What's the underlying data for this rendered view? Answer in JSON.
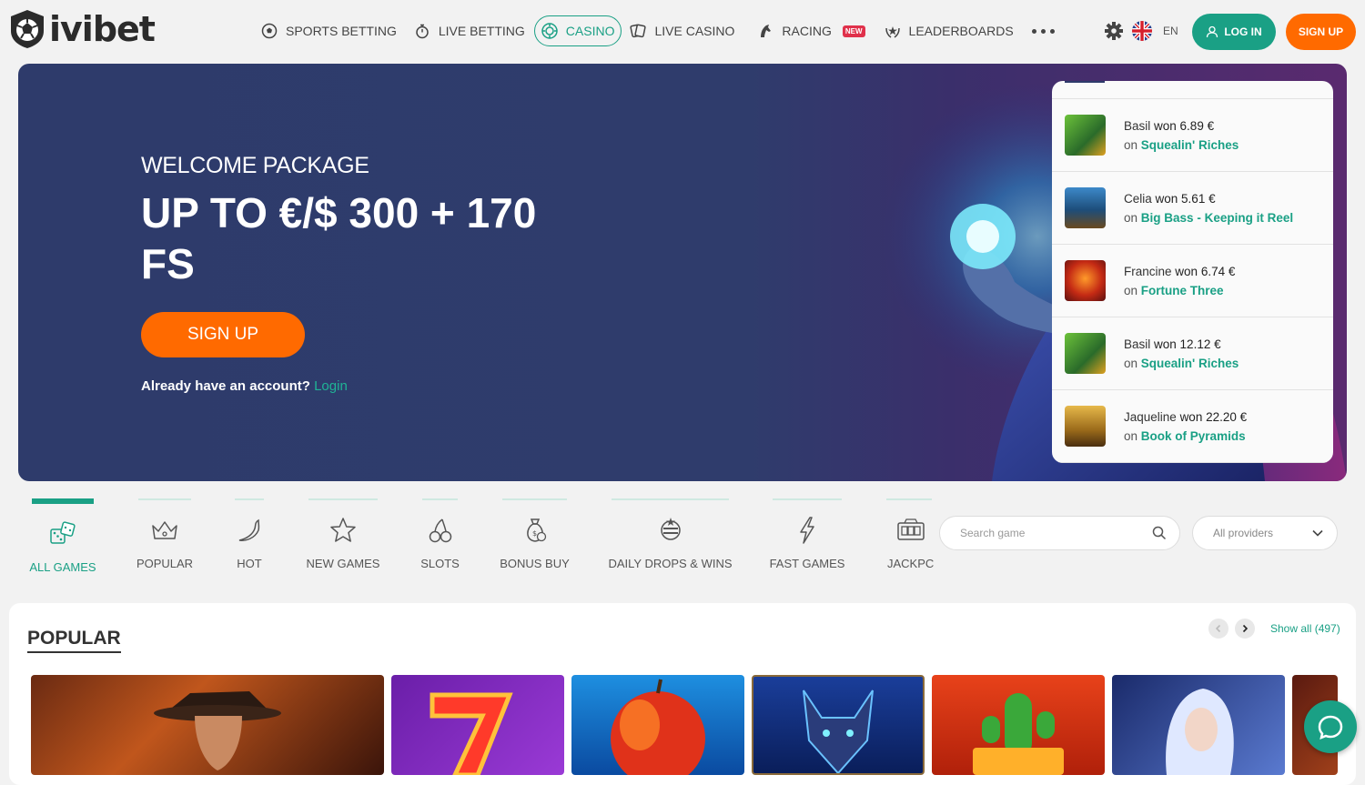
{
  "brand": {
    "name": "ivibet"
  },
  "nav": {
    "items": [
      {
        "label": "SPORTS BETTING",
        "icon": "soccer-ball-icon"
      },
      {
        "label": "LIVE BETTING",
        "icon": "stopwatch-icon"
      },
      {
        "label": "CASINO",
        "icon": "casino-chip-icon",
        "active": true
      },
      {
        "label": "LIVE CASINO",
        "icon": "cards-icon"
      },
      {
        "label": "RACING",
        "icon": "horse-icon",
        "badge": "NEW"
      },
      {
        "label": "LEADERBOARDS",
        "icon": "laurel-star-icon"
      }
    ],
    "more_icon": "more-dots-icon"
  },
  "header_right": {
    "language": "EN",
    "login_label": "LOG IN",
    "signup_label": "SIGN UP"
  },
  "hero": {
    "kicker": "WELCOME PACKAGE",
    "offer": "UP TO €/$ 300 + 170 FS",
    "signup_label": "SIGN UP",
    "account_text": "Already have an account?",
    "login_link": "Login"
  },
  "winners": [
    {
      "name": "Basil",
      "won_label": "won 6.89 €",
      "on": "on",
      "game": "Squealin' Riches",
      "thumb_color": "#3c7a2a"
    },
    {
      "name": "Celia",
      "won_label": "won 5.61 €",
      "on": "on",
      "game": "Big Bass - Keeping it Reel",
      "thumb_color": "#2a6b9a"
    },
    {
      "name": "Francine",
      "won_label": "won 6.74 €",
      "on": "on",
      "game": "Fortune Three",
      "thumb_color": "#b03a1e"
    },
    {
      "name": "Basil",
      "won_label": "won 12.12 €",
      "on": "on",
      "game": "Squealin' Riches",
      "thumb_color": "#3c7a2a"
    },
    {
      "name": "Jaqueline",
      "won_label": "won 22.20 €",
      "on": "on",
      "game": "Book of Pyramids",
      "thumb_color": "#8a6420"
    }
  ],
  "categories": [
    {
      "label": "ALL GAMES",
      "icon": "dice-icon",
      "active": true
    },
    {
      "label": "POPULAR",
      "icon": "crown-icon"
    },
    {
      "label": "HOT",
      "icon": "chili-pepper-icon"
    },
    {
      "label": "NEW GAMES",
      "icon": "star-icon"
    },
    {
      "label": "SLOTS",
      "icon": "cherries-icon"
    },
    {
      "label": "BONUS BUY",
      "icon": "money-bag-icon"
    },
    {
      "label": "DAILY DROPS & WINS",
      "icon": "drops-wins-icon"
    },
    {
      "label": "FAST GAMES",
      "icon": "lightning-icon"
    },
    {
      "label": "JACKPC",
      "icon": "jackpot-icon"
    }
  ],
  "search": {
    "placeholder": "Search game"
  },
  "providers": {
    "selected": "All providers"
  },
  "popular": {
    "title": "POPULAR",
    "show_all": "Show all (497)"
  },
  "colors": {
    "accent": "#1aa085",
    "orange": "#ff6a00",
    "hero_bg": "#2e3b6b"
  }
}
